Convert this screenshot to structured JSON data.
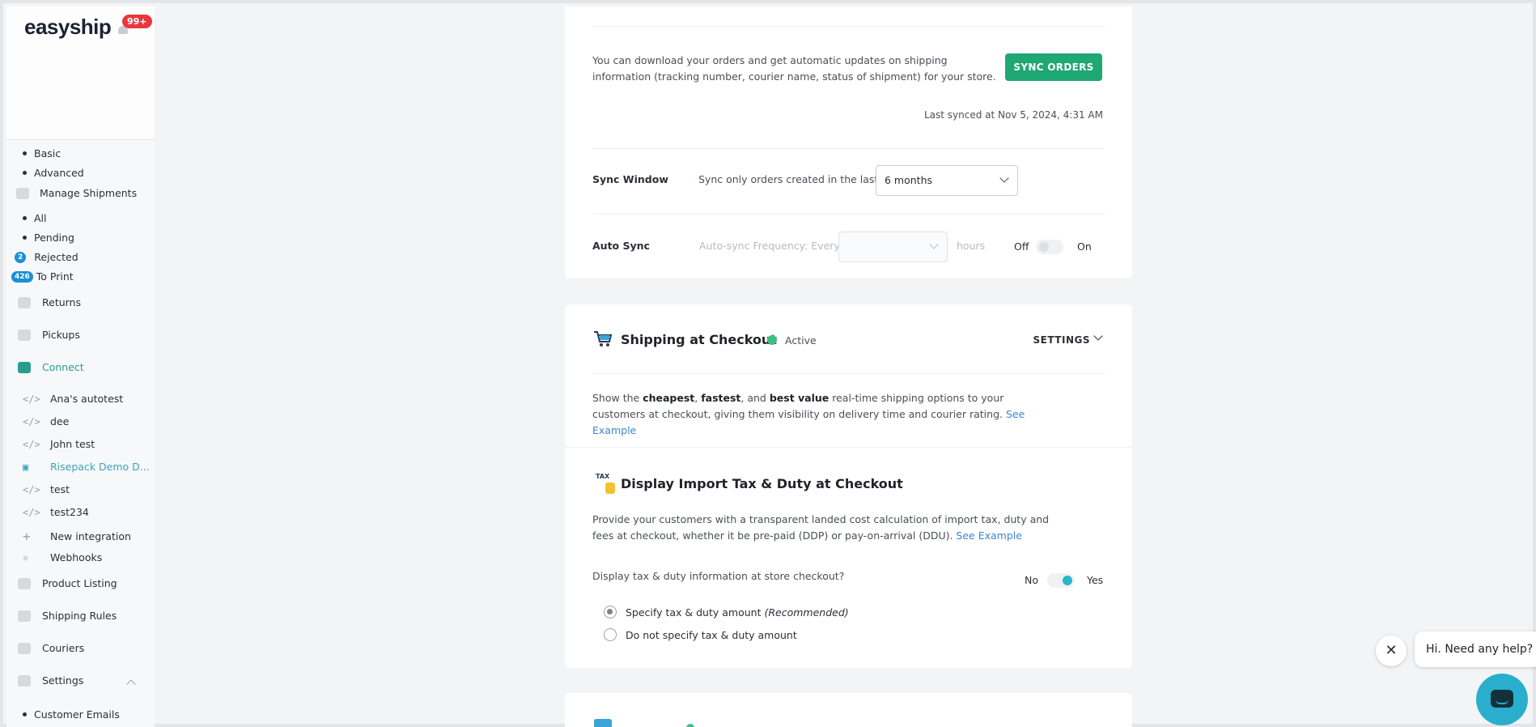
{
  "sidebar": {
    "logo": "easyship",
    "notification_count": "99+",
    "items": [
      {
        "label": "Basic"
      },
      {
        "label": "Advanced"
      },
      {
        "label": "Manage Shipments"
      },
      {
        "label": "All"
      },
      {
        "label": "Pending"
      },
      {
        "label": "Rejected",
        "badge": "2"
      },
      {
        "label": "To Print",
        "badge": "426"
      },
      {
        "label": "Returns"
      },
      {
        "label": "Pickups"
      },
      {
        "label": "Connect"
      },
      {
        "label": "Ana's autotest"
      },
      {
        "label": "dee"
      },
      {
        "label": "John test"
      },
      {
        "label": "Risepack Demo D..."
      },
      {
        "label": "test"
      },
      {
        "label": "test234"
      },
      {
        "label": "New integration"
      },
      {
        "label": "Webhooks"
      },
      {
        "label": "Product Listing"
      },
      {
        "label": "Shipping Rules"
      },
      {
        "label": "Couriers"
      },
      {
        "label": "Settings"
      },
      {
        "label": "Customer Emails"
      }
    ]
  },
  "sync": {
    "description": "You can download your orders and get automatic updates on shipping information (tracking number, courier name, status of shipment) for your store.",
    "button": "SYNC ORDERS",
    "last_synced": "Last synced at Nov 5, 2024, 4:31 AM",
    "window_label": "Sync Window",
    "window_text": "Sync only orders created in the last",
    "window_value": "6 months",
    "auto_label": "Auto Sync",
    "auto_text": "Auto-sync Frequency: Every",
    "auto_value": "",
    "auto_unit": "hours",
    "off": "Off",
    "on": "On"
  },
  "checkout": {
    "title": "Shipping at Checkout",
    "status": "Active",
    "settings": "SETTINGS",
    "para_prefix": "Show the ",
    "w_cheapest": "cheapest",
    "sep1": ", ",
    "w_fastest": "fastest",
    "sep2": ", and ",
    "w_best": "best value",
    "para_suffix": " real-time shipping options to your customers at checkout, giving them visibility on delivery time and courier rating. ",
    "see_example": "See Example",
    "tax_icon_text": "TAX",
    "tax_title": "Display Import Tax & Duty at Checkout",
    "tax_para": "Provide your customers with a transparent landed cost calculation of import tax, duty and fees at checkout, whether it be pre-paid (DDP) or pay-on-arrival (DDU). ",
    "tax_see_example": "See Example",
    "question": "Display tax & duty information at store checkout?",
    "no": "No",
    "yes": "Yes",
    "option1": "Specify tax & duty amount ",
    "option1_note": "(Recommended)",
    "option2": "Do not specify tax & duty amount"
  },
  "chat": {
    "message": "Hi. Need any help?",
    "close": "✕"
  },
  "colors": {
    "accent_green": "#1fa774",
    "status_green": "#3cc083",
    "toggle_teal": "#2ab7c7",
    "link_blue": "#3a86d4",
    "chat_teal": "#2aaecd"
  }
}
